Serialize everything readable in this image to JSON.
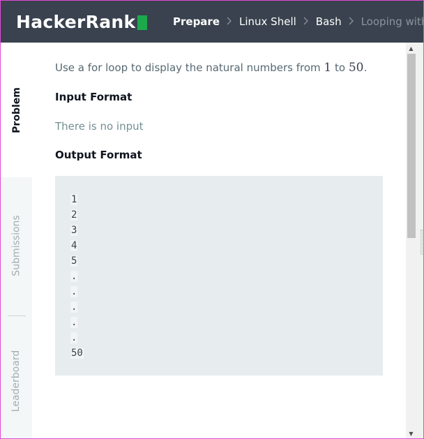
{
  "header": {
    "logo_text": "HackerRank",
    "brand_color": "#1ba94c",
    "breadcrumbs": [
      "Prepare",
      "Linux Shell",
      "Bash",
      "Looping with N"
    ],
    "separator_icon": "chevron-right-icon"
  },
  "sidebar": {
    "tabs": [
      {
        "label": "Problem",
        "active": true
      },
      {
        "label": "Submissions",
        "active": false
      },
      {
        "label": "Leaderboard",
        "active": false
      }
    ]
  },
  "problem": {
    "description_prefix": "Use a for loop to display the natural numbers from ",
    "from_value": "1",
    "description_middle": " to ",
    "to_value": "50",
    "description_suffix": ".",
    "input_heading": "Input Format",
    "input_text": "There is no input",
    "output_heading": "Output Format",
    "output_lines": [
      "1",
      "2",
      "3",
      "4",
      "5",
      ".",
      ".",
      ".",
      ".",
      ".",
      "50"
    ]
  },
  "scrollbar": {
    "up_icon": "triangle-up-icon",
    "down_icon": "triangle-down-icon"
  }
}
